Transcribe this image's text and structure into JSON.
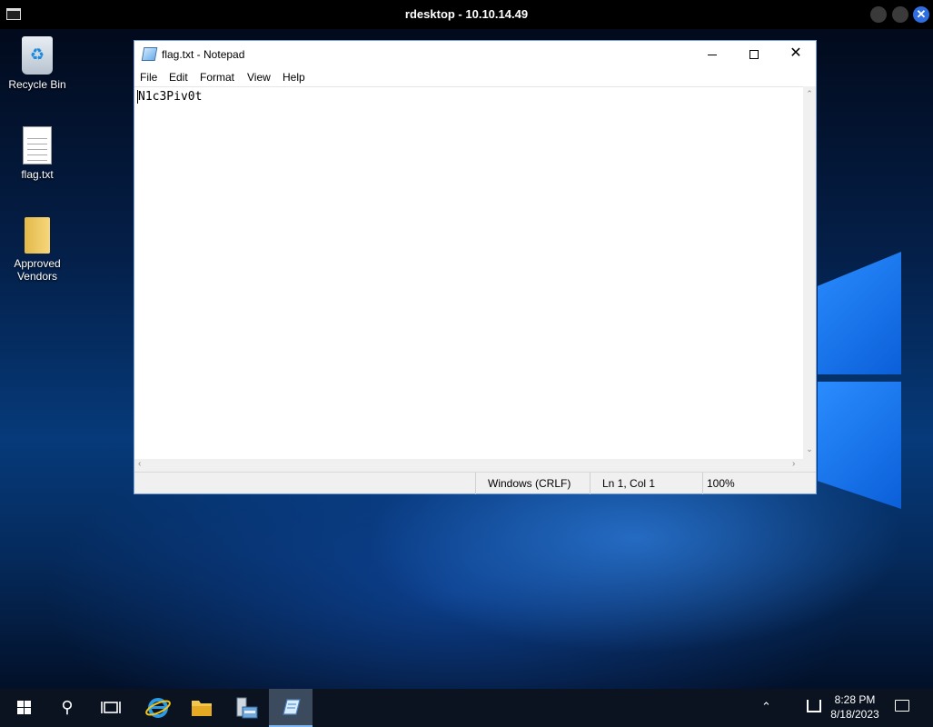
{
  "rdesktop": {
    "title": "rdesktop - 10.10.14.49",
    "close_glyph": "✕"
  },
  "desktop_icons": [
    {
      "label": "Recycle Bin",
      "icon": "recycle-bin-icon"
    },
    {
      "label": "flag.txt",
      "icon": "text-file-icon"
    },
    {
      "label": "Approved Vendors",
      "icon": "folder-icon"
    }
  ],
  "notepad": {
    "title": "flag.txt - Notepad",
    "menu": [
      "File",
      "Edit",
      "Format",
      "View",
      "Help"
    ],
    "content": "N1c3Piv0t",
    "status": {
      "line_ending": "Windows (CRLF)",
      "position": "Ln 1, Col 1",
      "zoom": "100%"
    },
    "close_glyph": "✕"
  },
  "taskbar": {
    "items": [
      "start-icon",
      "search-icon",
      "task-view-icon",
      "internet-explorer-icon",
      "file-explorer-icon",
      "server-manager-icon",
      "notepad-icon"
    ],
    "active": "notepad-icon",
    "tray_arrow": "⌃",
    "time": "8:28 PM",
    "date": "8/18/2023"
  },
  "colors": {
    "taskbar": "#0b1320",
    "desktop_accent": "#0b5fd8",
    "rdesktop_close": "#2f6ee0"
  }
}
